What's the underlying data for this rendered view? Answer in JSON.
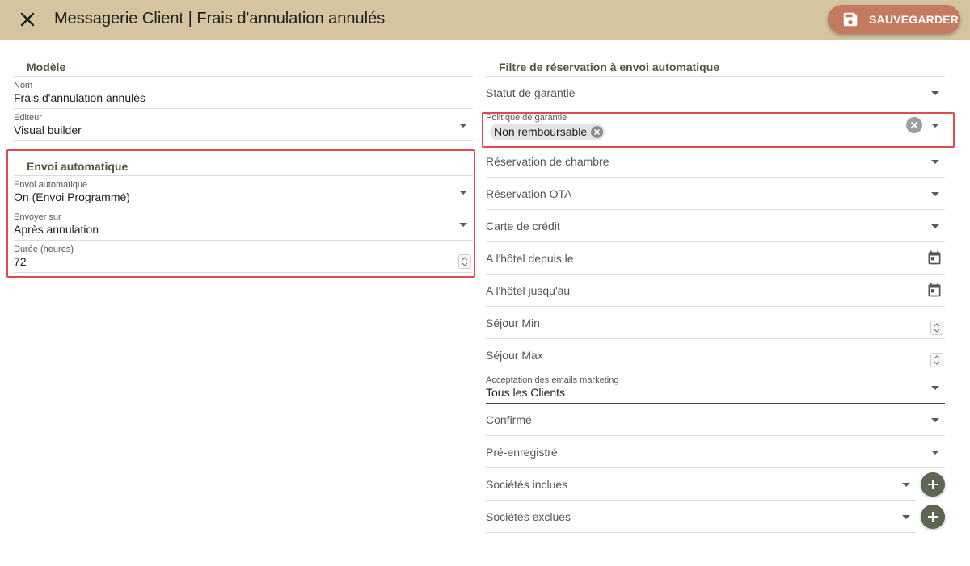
{
  "header": {
    "title": "Messagerie Client | Frais d'annulation annulés",
    "save_label": "SAUVEGARDER"
  },
  "modele": {
    "section_title": "Modèle",
    "nom": {
      "label": "Nom",
      "value": "Frais d'annulation annulés"
    },
    "editeur": {
      "label": "Editeur",
      "value": "Visual builder"
    }
  },
  "envoi": {
    "section_title": "Envoi automatique",
    "envoi_automatique": {
      "label": "Envoi automatique",
      "value": "On (Envoi Programmé)"
    },
    "envoyer_sur": {
      "label": "Envoyer sur",
      "value": "Après annulation"
    },
    "duree": {
      "label": "Durée (heures)",
      "value": "72"
    }
  },
  "filtre": {
    "section_title": "Filtre de réservation à envoi automatique",
    "statut_garantie": "Statut de garantie",
    "politique_garantie": {
      "label": "Politique de garantie",
      "chip": "Non remboursable"
    },
    "reservation_chambre": "Réservation de chambre",
    "reservation_ota": "Réservation OTA",
    "carte_credit": "Carte de crédit",
    "hotel_depuis": "A l'hôtel depuis le",
    "hotel_jusqua": "A l'hôtel jusqu'au",
    "sejour_min": "Séjour Min",
    "sejour_max": "Séjour Max",
    "acceptation_emails": {
      "label": "Acceptation des emails marketing",
      "value": "Tous les Clients"
    },
    "confirme": "Confirmé",
    "pre_enregistre": "Pré-enregistré",
    "societes_incluses": "Sociétés inclues",
    "societes_exclues": "Sociétés exclues"
  },
  "colors": {
    "header_bg": "#d4c4a0",
    "save_button": "#c47a5e",
    "section_title": "#4d5a3e",
    "highlight": "#e0494f",
    "add_button": "#5d6650"
  }
}
